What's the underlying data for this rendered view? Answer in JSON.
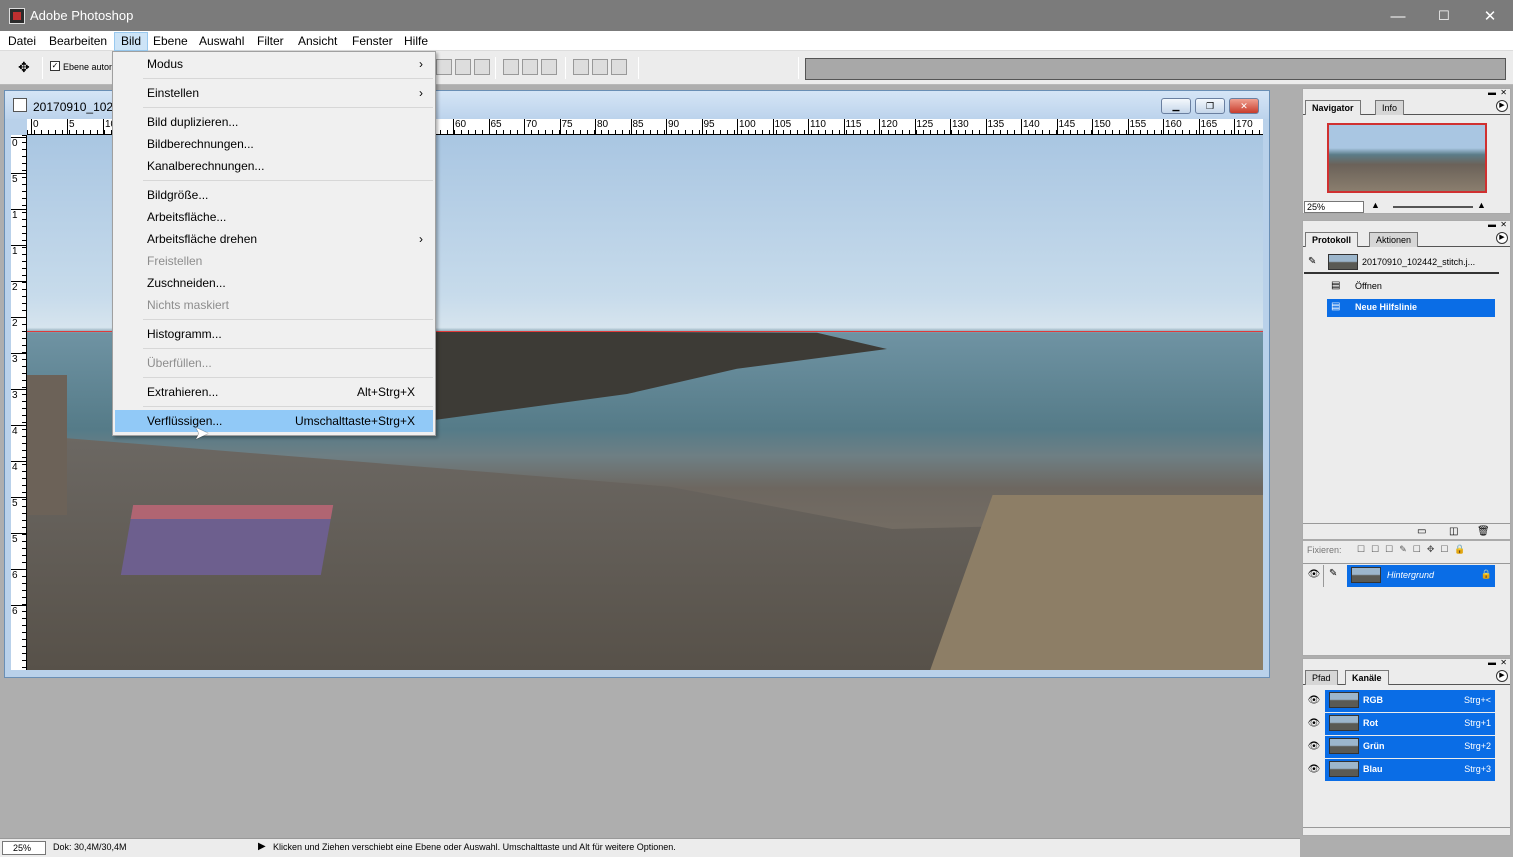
{
  "window": {
    "title": "Adobe Photoshop",
    "min": "—",
    "max": "☐",
    "close": "✕"
  },
  "menubar": {
    "items": [
      "Datei",
      "Bearbeiten",
      "Bild",
      "Ebene",
      "Auswahl",
      "Filter",
      "Ansicht",
      "Fenster",
      "Hilfe"
    ],
    "active": "Bild"
  },
  "options": {
    "move_tool_icon": "move-icon",
    "auto_select_label": "Ebene autom"
  },
  "document": {
    "title": "20170910_102442",
    "ruler_h": [
      "0",
      "5",
      "10",
      "60",
      "65",
      "70",
      "75",
      "80",
      "85",
      "90",
      "95",
      "100",
      "105",
      "110",
      "115",
      "120",
      "125",
      "130",
      "135",
      "140",
      "145",
      "150",
      "155",
      "160",
      "165",
      "170"
    ],
    "ruler_v": [
      "0",
      "5",
      "1",
      "1",
      "2",
      "2",
      "3",
      "3",
      "4",
      "4",
      "5",
      "5",
      "6",
      "6"
    ]
  },
  "bild_menu": {
    "items": [
      {
        "label": "Modus",
        "submenu": true
      },
      {
        "label": "Einstellen",
        "submenu": true
      },
      {
        "label": "Bild duplizieren..."
      },
      {
        "label": "Bildberechnungen..."
      },
      {
        "label": "Kanalberechnungen..."
      },
      {
        "label": "Bildgröße..."
      },
      {
        "label": "Arbeitsfläche..."
      },
      {
        "label": "Arbeitsfläche drehen",
        "submenu": true
      },
      {
        "label": "Freistellen",
        "disabled": true
      },
      {
        "label": "Zuschneiden..."
      },
      {
        "label": "Nichts maskiert",
        "disabled": true
      },
      {
        "label": "Histogramm..."
      },
      {
        "label": "Überfüllen...",
        "disabled": true
      },
      {
        "label": "Extrahieren...",
        "shortcut": "Alt+Strg+X"
      },
      {
        "label": "Verflüssigen...",
        "shortcut": "Umschalttaste+Strg+X",
        "highlighted": true
      }
    ]
  },
  "navigator": {
    "tabs": [
      "Navigator",
      "Info"
    ],
    "zoom": "25%"
  },
  "history": {
    "tabs": [
      "Protokoll",
      "Aktionen"
    ],
    "snapshot": "20170910_102442_stitch.j...",
    "steps": [
      "Öffnen",
      "Neue Hilfslinie"
    ]
  },
  "layers": {
    "fix_label": "Fixieren:",
    "layer": "Hintergrund"
  },
  "channels": {
    "tabs": [
      "Pfad",
      "Kanäle"
    ],
    "items": [
      {
        "name": "RGB",
        "shortcut": "Strg+<"
      },
      {
        "name": "Rot",
        "shortcut": "Strg+1"
      },
      {
        "name": "Grün",
        "shortcut": "Strg+2"
      },
      {
        "name": "Blau",
        "shortcut": "Strg+3"
      }
    ]
  },
  "status": {
    "zoom": "25%",
    "doc": "Dok: 30,4M/30,4M",
    "hint": "Klicken und Ziehen verschiebt eine Ebene oder Auswahl.  Umschalttaste und Alt für weitere Optionen."
  }
}
